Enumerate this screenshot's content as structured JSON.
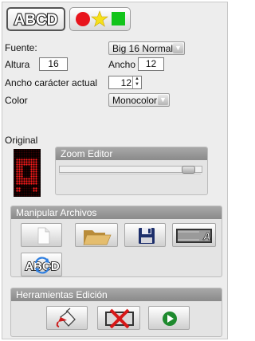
{
  "tabs": [
    {
      "label": "ABCD"
    },
    {
      "label": "shapes"
    }
  ],
  "font_label": "Fuente:",
  "font_value": "Big 16 Normal",
  "height_label": "Altura",
  "height_value": "16",
  "width_label": "Ancho",
  "width_value": "12",
  "char_width_label": "Ancho carácter actual",
  "char_width_value": "12",
  "color_label": "Color",
  "color_value": "Monocolor",
  "original_label": "Original",
  "zoom_editor_title": "Zoom Editor",
  "files_section_title": "Manipular Archivos",
  "tools_section_title": "Herramientas Edición",
  "icons": {
    "file_buttons": [
      "new-file-icon",
      "open-folder-icon",
      "save-disk-icon",
      "film-a-icon",
      "abcd-convert-icon"
    ],
    "tool_buttons": [
      "paint-bucket-icon",
      "delete-film-icon",
      "play-icon"
    ]
  },
  "colors": {
    "accent_red": "#e8141c",
    "accent_green": "#12c41a",
    "accent_yellow": "#f6e01a",
    "section_header": "#999999"
  }
}
